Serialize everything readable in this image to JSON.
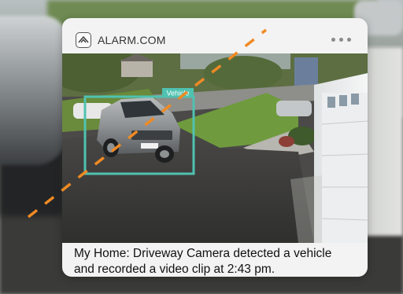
{
  "notification": {
    "app_name": "ALARM.COM",
    "app_icon": "alarm-com-logo-icon",
    "more_icon": "more-options-icon",
    "snapshot": {
      "detection_label": "Vehicle",
      "detection_box_color": "#4fc2b1"
    },
    "message_lines": [
      "My Home: Driveway Camera detected a vehicle",
      "and recorded a video clip at 2:43 pm."
    ]
  },
  "overlay": {
    "line_color": "#f08a24",
    "line_style": "dashed"
  }
}
